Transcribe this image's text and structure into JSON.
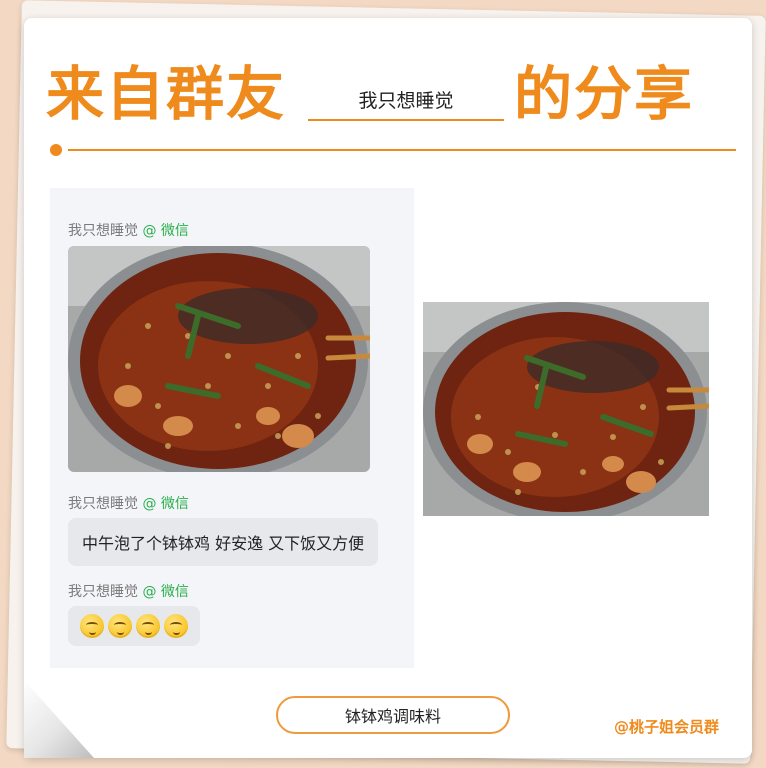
{
  "header": {
    "title_left": "来自群友",
    "name": "我只想睡觉",
    "title_right": "的分享"
  },
  "chat": {
    "messages": [
      {
        "sender": "我只想睡觉",
        "at": "@ 微信",
        "type": "image",
        "image": "hot-pot-photo"
      },
      {
        "sender": "我只想睡觉",
        "at": "@ 微信",
        "type": "text",
        "text": "中午泡了个钵钵鸡 好安逸 又下饭又方便"
      },
      {
        "sender": "我只想睡觉",
        "at": "@ 微信",
        "type": "emoji",
        "emoji": "thinking-emoji",
        "count": 4
      }
    ]
  },
  "featured_image": "hot-pot-photo",
  "button": {
    "label": "钵钵鸡调味料"
  },
  "footer": {
    "tag": "@桃子姐会员群"
  },
  "colors": {
    "accent": "#ef8a1c",
    "wechat_green": "#27b04a",
    "bubble_bg": "#e6e8ec"
  }
}
